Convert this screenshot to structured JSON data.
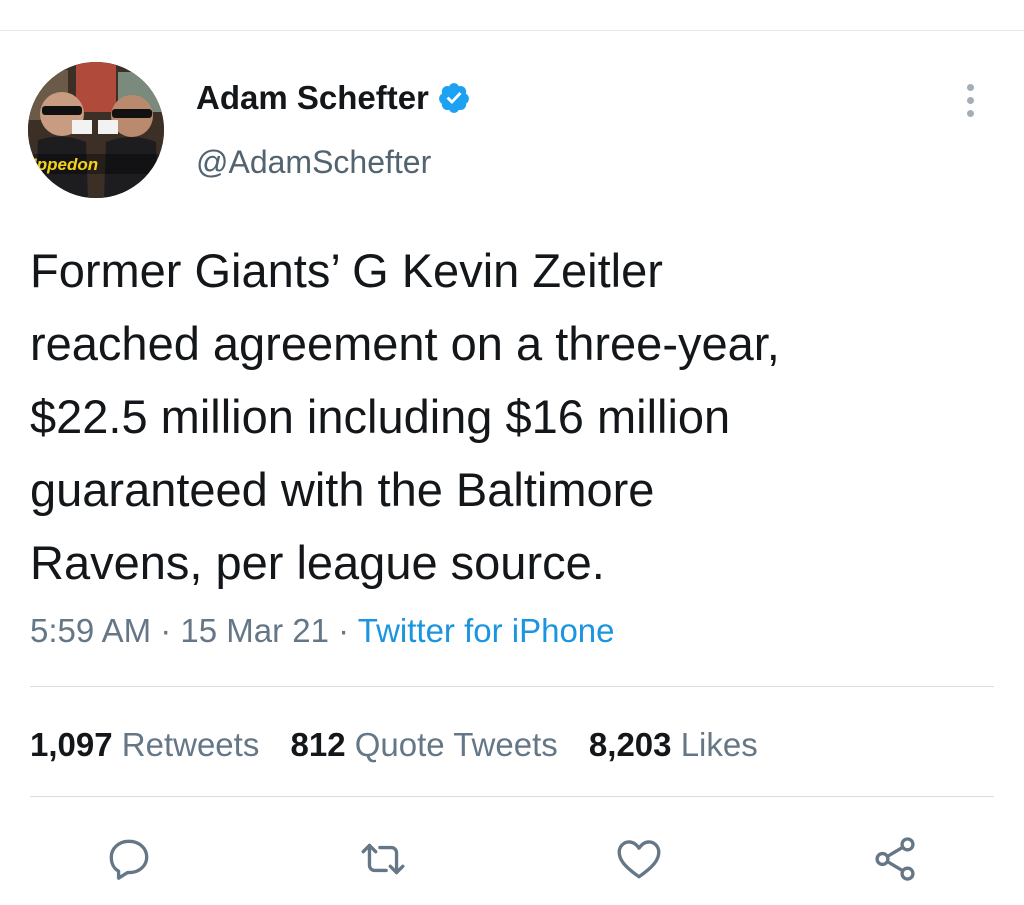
{
  "author": {
    "name": "Adam Schefter",
    "handle": "@AdamSchefter",
    "avatar_banner": "Ippedon",
    "verified": true
  },
  "tweet": {
    "text": "Former Giants’ G Kevin Zeitler\nreached agreement on a three-year,\n$22.5 million including $16 million\nguaranteed with the Baltimore\nRavens, per league source.",
    "time": "5:59 AM",
    "date": "15 Mar 21",
    "source": "Twitter for iPhone",
    "dot": " · "
  },
  "stats": {
    "retweets_count": "1,097",
    "retweets_label": "Retweets",
    "quotes_count": "812",
    "quotes_label": "Quote Tweets",
    "likes_count": "8,203",
    "likes_label": "Likes"
  },
  "icons": {
    "verified": "verified-badge-icon",
    "more": "more-vertical-icon",
    "reply": "reply-icon",
    "retweet": "retweet-icon",
    "like": "heart-icon",
    "share": "share-icon"
  },
  "colors": {
    "accent": "#1b95e0",
    "text": "#14171a",
    "secondary": "#657786",
    "verified": "#1da1f2"
  }
}
